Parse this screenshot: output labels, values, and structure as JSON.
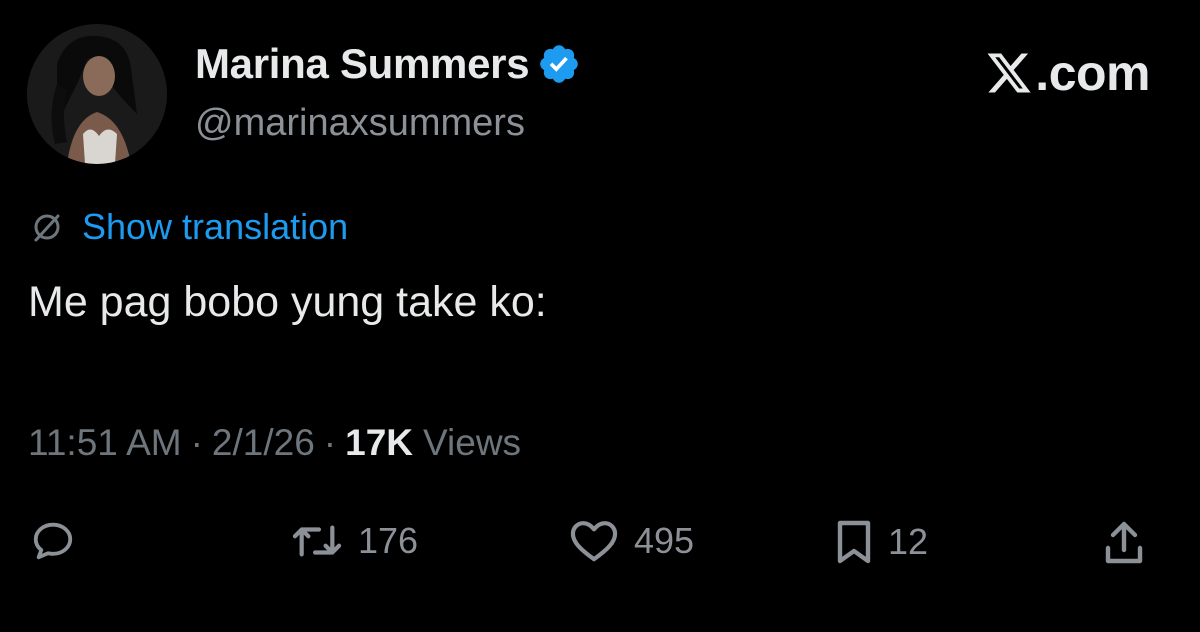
{
  "author": {
    "display_name": "Marina Summers",
    "handle": "@marinaxsummers",
    "verified": true,
    "avatar": "profile-photo"
  },
  "brand": {
    "logo": "x-logo-icon",
    "suffix": ".com"
  },
  "translation": {
    "label": "Show translation"
  },
  "tweet": {
    "text": "Me pag bobo yung take ko:"
  },
  "meta": {
    "time": "11:51 AM",
    "separator": "·",
    "date": "2/1/26",
    "views_count": "17K",
    "views_label": "Views"
  },
  "actions": {
    "reply": {
      "icon": "reply-icon"
    },
    "retweet": {
      "icon": "retweet-icon",
      "count": "176"
    },
    "like": {
      "icon": "heart-icon",
      "count": "495"
    },
    "bookmark": {
      "icon": "bookmark-icon",
      "count": "12"
    },
    "share": {
      "icon": "share-icon"
    }
  },
  "colors": {
    "background": "#000000",
    "text_primary": "#e7e9ea",
    "text_secondary": "#8b9197",
    "link": "#1d9bf0",
    "verified_badge": "#1d9bf0"
  }
}
